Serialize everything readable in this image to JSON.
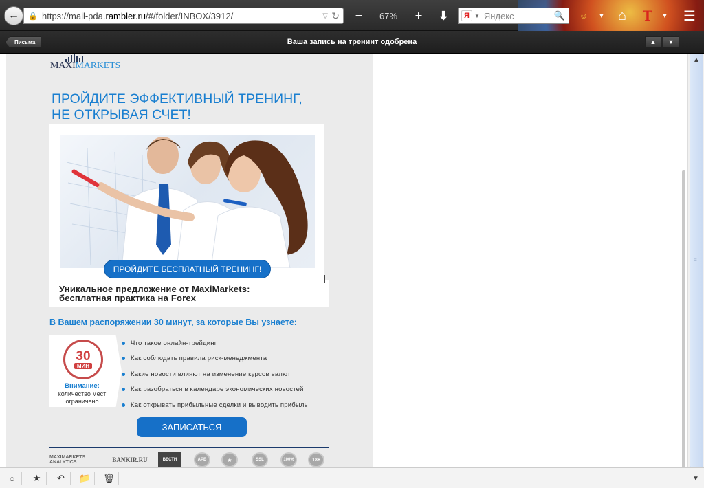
{
  "browser": {
    "url_prefix": "https://mail-pda.",
    "url_host": "rambler.ru",
    "url_path": "/#/folder/INBOX/3912/",
    "zoom": "67%",
    "search_engine_glyph": "Я",
    "search_placeholder": "Яндекс",
    "theme_letter": "T"
  },
  "mail": {
    "folder_button": "Письма",
    "subject": "Ваша запись на тренинт одобрена"
  },
  "email": {
    "logo_maxi": "MAXI",
    "logo_markets": "MARKETS",
    "headline_line1": "Пройдите эффективный тренинг,",
    "headline_line2": "не открывая счет!",
    "photo_cta": "ПРОЙДИТЕ БЕСПЛАТНЫЙ ТРЕНИНГ!",
    "offer_line1": "Уникальное предложение от MaxiMarkets:",
    "offer_line2": "бесплатная практика на Forex",
    "sub_headline": "В Вашем распоряжении 30 минут, за которые Вы узнаете:",
    "badge_number": "30",
    "badge_unit": "МИН",
    "badge_warning": "Внимание:",
    "badge_text_1": "количество мест",
    "badge_text_2": "ограничено",
    "bullets": [
      "Что такое онлайн-трейдинг",
      "Как соблюдать правила риск-менеджмента",
      "Какие новости влияют на изменение курсов валют",
      "Как разобраться в календаре экономических новостей",
      "Как открывать прибыльные сделки и выводить прибыль"
    ],
    "signup_button": "ЗАПИСАТЬСЯ",
    "partners": {
      "analytics": "MAXIMARKETS ANALYTICS",
      "bankir": "BANKIR.RU",
      "vesti": "ВЕСТИ",
      "arb": "АРБ",
      "ssl": "SSL",
      "hundred": "100%",
      "age": "18+"
    }
  },
  "colors": {
    "accent_blue": "#1a7fd0",
    "button_blue": "#1670c8",
    "email_bg": "#ebebeb"
  }
}
